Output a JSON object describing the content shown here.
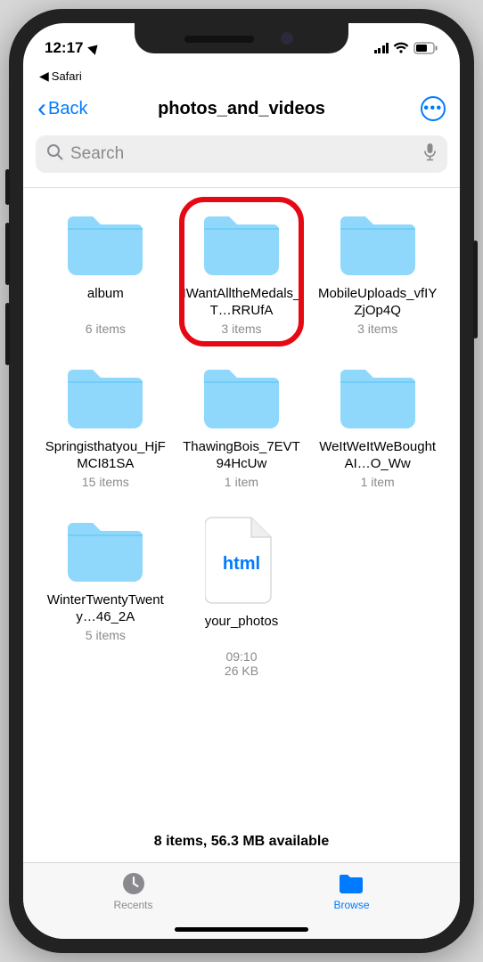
{
  "status": {
    "time": "12:17",
    "breadcrumb_app": "Safari"
  },
  "nav": {
    "back_label": "Back",
    "title": "photos_and_videos"
  },
  "search": {
    "placeholder": "Search"
  },
  "items": [
    {
      "type": "folder",
      "name": "album",
      "sub": "6 items",
      "highlight": false
    },
    {
      "type": "folder",
      "name": "IWantAlltheMedals_T…RRUfA",
      "sub": "3 items",
      "highlight": true
    },
    {
      "type": "folder",
      "name": "MobileUploads_vfIYZjOp4Q",
      "sub": "3 items",
      "highlight": false
    },
    {
      "type": "folder",
      "name": "Springisthatyou_HjFMCI81SA",
      "sub": "15 items",
      "highlight": false
    },
    {
      "type": "folder",
      "name": "ThawingBois_7EVT94HcUw",
      "sub": "1 item",
      "highlight": false
    },
    {
      "type": "folder",
      "name": "WeItWeItWeBoughtAI…O_Ww",
      "sub": "1 item",
      "highlight": false
    },
    {
      "type": "folder",
      "name": "WinterTwentyTwenty…46_2A",
      "sub": "5 items",
      "highlight": false
    },
    {
      "type": "html",
      "name": "your_photos",
      "sub": "09:10",
      "sub2": "26 KB",
      "ext": "html",
      "highlight": false
    }
  ],
  "footer": {
    "summary": "8 items, 56.3 MB available"
  },
  "tabs": {
    "recents": "Recents",
    "browse": "Browse"
  }
}
